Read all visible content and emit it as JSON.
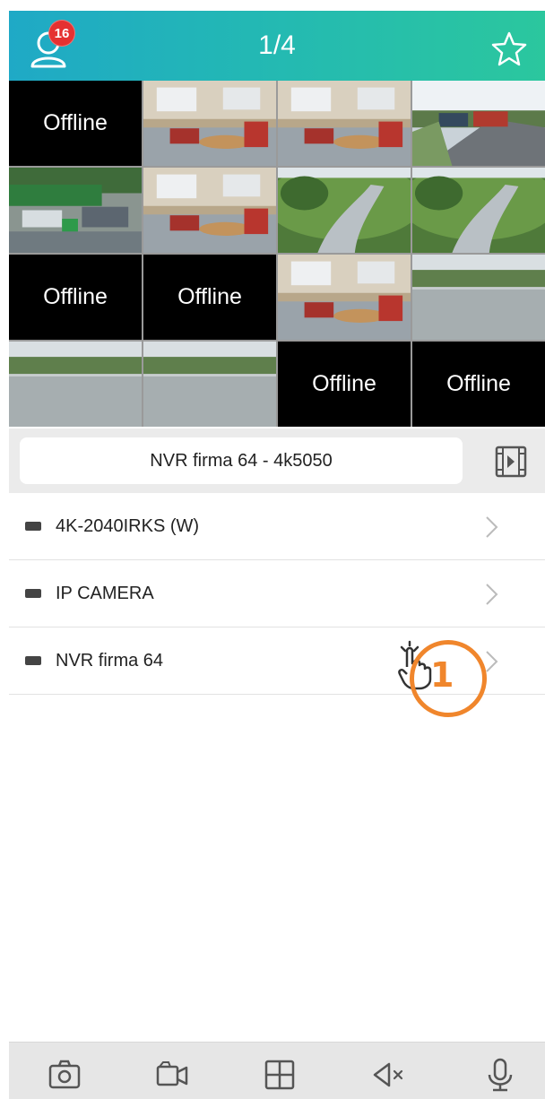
{
  "header": {
    "notification_count": "16",
    "page_indicator": "1/4",
    "gradient_start": "#1fa9c6",
    "gradient_end": "#2bc79e"
  },
  "grid": {
    "offline_label": "Offline",
    "cells": [
      {
        "state": "offline"
      },
      {
        "state": "video",
        "scene": "indoor-room"
      },
      {
        "state": "video",
        "scene": "indoor-room"
      },
      {
        "state": "video",
        "scene": "street-trucks"
      },
      {
        "state": "video",
        "scene": "parking-lot"
      },
      {
        "state": "video",
        "scene": "indoor-room"
      },
      {
        "state": "video",
        "scene": "fisheye-path"
      },
      {
        "state": "video",
        "scene": "fisheye-path"
      },
      {
        "state": "offline"
      },
      {
        "state": "offline"
      },
      {
        "state": "video",
        "scene": "indoor-room"
      },
      {
        "state": "video",
        "scene": "outdoor-lawn"
      },
      {
        "state": "video",
        "scene": "outdoor-lawn"
      },
      {
        "state": "video",
        "scene": "outdoor-lawn"
      },
      {
        "state": "offline"
      },
      {
        "state": "offline"
      }
    ]
  },
  "device_bar": {
    "current_device": "NVR firma 64 - 4k5050"
  },
  "device_list": [
    {
      "label": "4K-2040IRKS (W)"
    },
    {
      "label": "IP CAMERA"
    },
    {
      "label": "NVR firma 64"
    }
  ],
  "annotation": {
    "step_number": "1",
    "color": "#f0862c"
  },
  "bottom_bar": {
    "icons": [
      "camera-icon",
      "video-record-icon",
      "grid-layout-icon",
      "mute-icon",
      "microphone-icon"
    ]
  }
}
